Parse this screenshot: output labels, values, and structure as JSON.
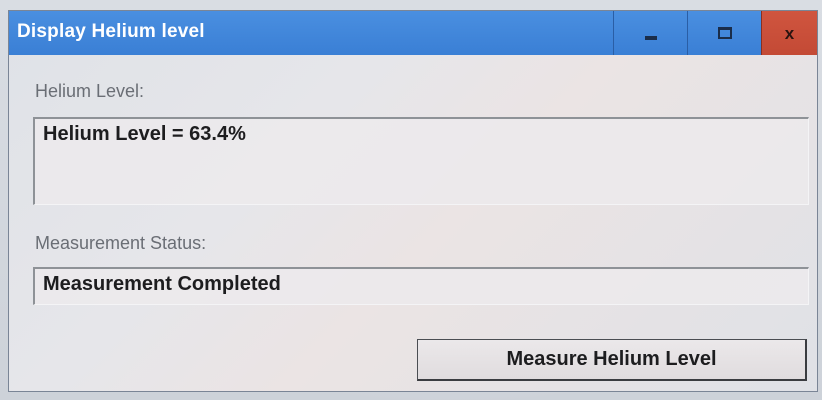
{
  "window": {
    "title": "Display Helium level",
    "controls": {
      "minimize": "minimize-icon",
      "maximize": "maximize-icon",
      "close": "close-icon",
      "close_glyph": "x"
    }
  },
  "helium": {
    "label": "Helium Level:",
    "value": "Helium Level = 63.4%"
  },
  "status": {
    "label": "Measurement Status:",
    "value": "Measurement Completed"
  },
  "actions": {
    "measure_label": "Measure Helium Level"
  },
  "colors": {
    "titlebar": "#3a7fd5",
    "close_button": "#c34a35"
  }
}
